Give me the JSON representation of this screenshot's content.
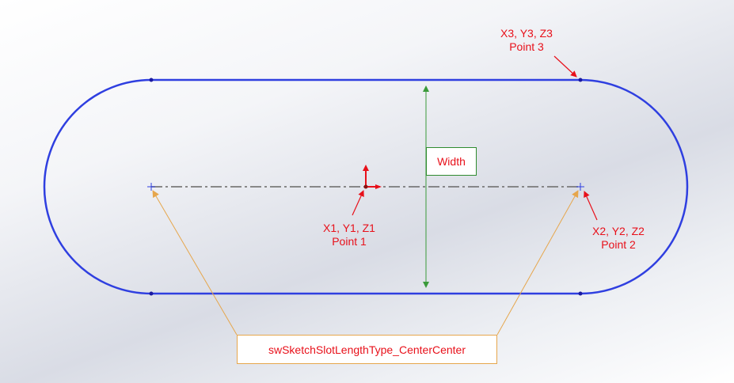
{
  "labels": {
    "point3_coords": "X3, Y3, Z3",
    "point3_name": "Point 3",
    "point1_coords": "X1, Y1, Z1",
    "point1_name": "Point 1",
    "point2_coords": "X2, Y2, Z2",
    "point2_name": "Point 2",
    "width": "Width",
    "slot_type": "swSketchSlotLengthType_CenterCenter"
  },
  "colors": {
    "slot_outline": "#2f3fe0",
    "centerline": "#7a7a7a",
    "dimension": "#3a9a3a",
    "leader": "#e6a64c",
    "annotation_text": "#e8101a"
  }
}
